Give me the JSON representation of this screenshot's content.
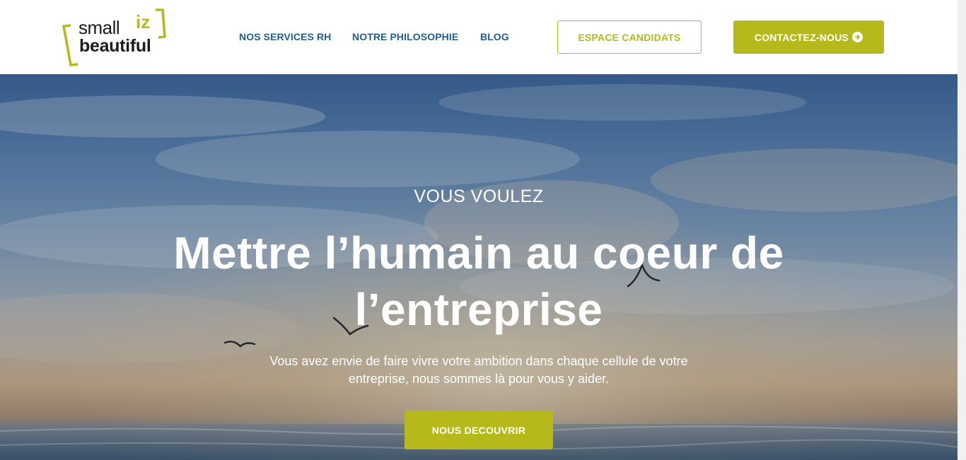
{
  "logo": {
    "word_small": "small",
    "word_iz": "iz",
    "word_beautiful": "beautiful"
  },
  "nav": {
    "items": [
      {
        "label": "NOS SERVICES RH"
      },
      {
        "label": "NOTRE PHILOSOPHIE"
      },
      {
        "label": "BLOG"
      }
    ],
    "candidats_label": "ESPACE CANDIDATS",
    "contact_label": "CONTACTEZ-NOUS",
    "contact_icon": "arrow-circle-right-icon"
  },
  "hero": {
    "eyebrow": "VOUS VOULEZ",
    "headline": "Mettre l’humain au coeur de l’entreprise",
    "subtext": "Vous avez envie de faire vivre votre ambition dans chaque cellule de votre entreprise, nous sommes là pour vous y aider.",
    "cta_label": "NOUS DECOUVRIR"
  },
  "colors": {
    "accent": "#b5b91a",
    "nav_text": "#245d8f",
    "logo_text": "#1c1c1c"
  }
}
